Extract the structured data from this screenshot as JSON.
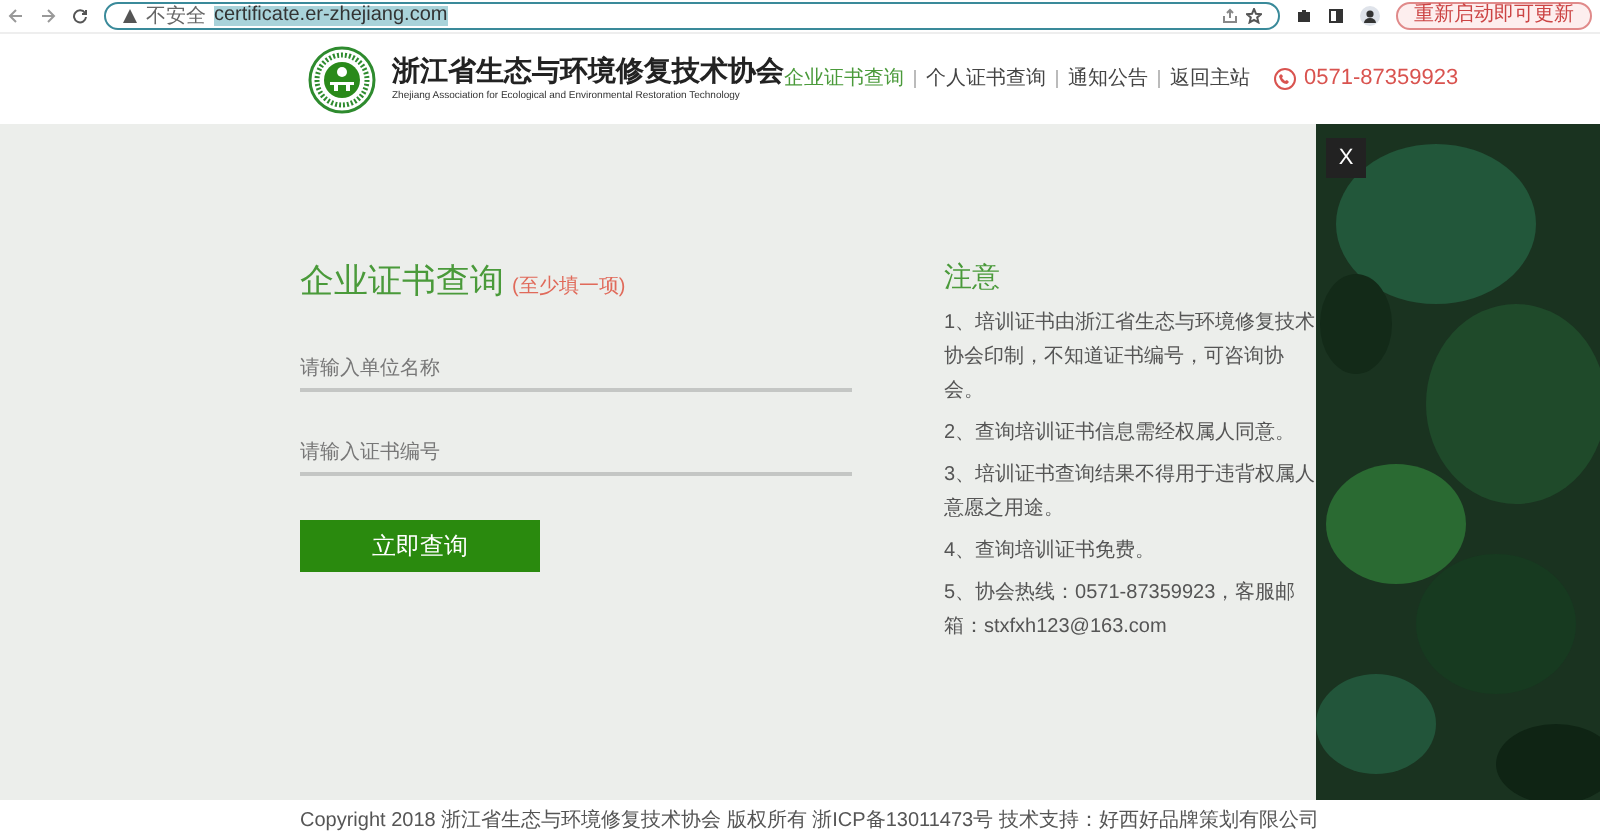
{
  "browser": {
    "security_label": "不安全",
    "url": "certificate.er-zhejiang.com",
    "update_button": "重新启动即可更新"
  },
  "header": {
    "org_name": "浙江省生态与环境修复技术协会",
    "org_name_en": "Zhejiang Association for Ecological and Environmental Restoration Technology",
    "nav": [
      {
        "label": "企业证书查询",
        "selected": true
      },
      {
        "label": "个人证书查询",
        "selected": false
      },
      {
        "label": "通知公告",
        "selected": false
      },
      {
        "label": "返回主站",
        "selected": false
      }
    ],
    "phone": "0571-87359923"
  },
  "query": {
    "title": "企业证书查询",
    "hint": "(至少填一项)",
    "fields": [
      {
        "placeholder": "请输入单位名称"
      },
      {
        "placeholder": "请输入证书编号"
      }
    ],
    "submit": "立即查询"
  },
  "notice": {
    "title": "注意",
    "items": [
      "1、培训证书由浙江省生态与环境修复技术协会印制，不知道证书编号，可咨询协会。",
      "2、查询培训证书信息需经权属人同意。",
      "3、培训证书查询结果不得用于违背权属人意愿之用途。",
      "4、查询培训证书免费。",
      "5、协会热线：0571-87359923，客服邮箱：stxfxh123@163.com"
    ]
  },
  "side_panel": {
    "close": "X"
  },
  "footer": "Copyright 2018 浙江省生态与环境修复技术协会 版权所有 浙ICP备13011473号 技术支持：好西好品牌策划有限公司"
}
